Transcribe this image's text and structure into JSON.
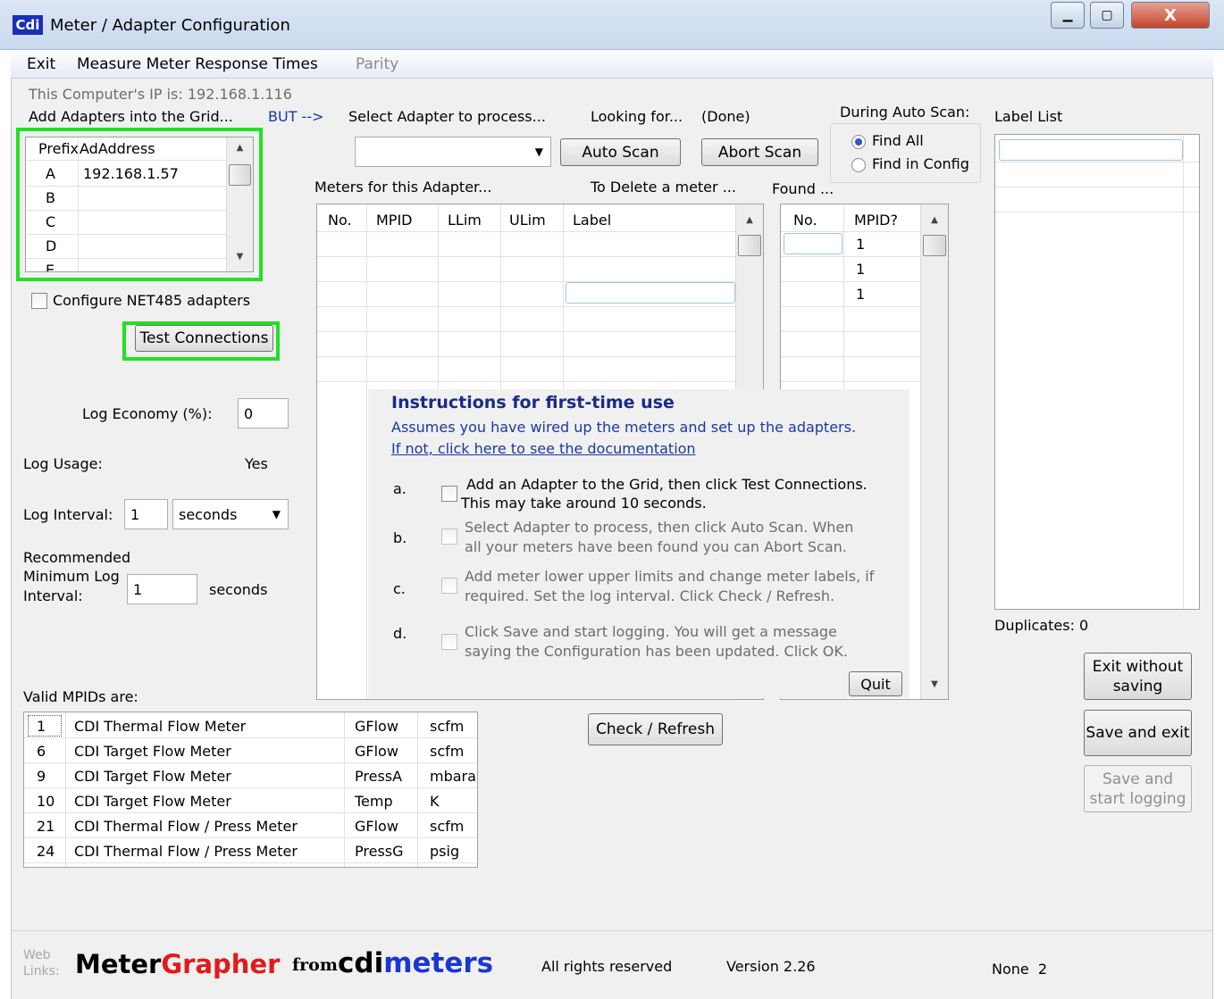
{
  "window": {
    "app_icon": "Cdi",
    "title": "Meter / Adapter Configuration",
    "min_glyph": "▁",
    "max_glyph": "▢",
    "close_glyph": "X"
  },
  "menu": {
    "items": [
      "Exit",
      "Measure Meter Response Times",
      "Parity"
    ]
  },
  "left": {
    "ip_text": "This Computer's IP is:  192.168.1.116",
    "add_adapters_text": "Add Adapters into the Grid...",
    "but_text": "BUT -->",
    "adapter_grid": {
      "headers": [
        "Prefix",
        "AdAddress"
      ],
      "rows": [
        {
          "prefix": "A",
          "address": "192.168.1.57"
        },
        {
          "prefix": "B",
          "address": ""
        },
        {
          "prefix": "C",
          "address": ""
        },
        {
          "prefix": "D",
          "address": ""
        },
        {
          "prefix": "E",
          "address": ""
        }
      ]
    },
    "net485_label": "Configure NET485 adapters",
    "test_connections": "Test Connections",
    "log_economy_label": "Log Economy (%):",
    "log_economy_value": "0",
    "log_usage_label": "Log Usage:",
    "log_usage_value": "Yes",
    "log_interval_label": "Log Interval:",
    "log_interval_value": "1",
    "log_interval_unit": "seconds",
    "recommended_label_1": "Recommended",
    "recommended_label_2": "Minimum Log",
    "recommended_label_3": "Interval:",
    "recommended_value": "1",
    "recommended_unit": "seconds",
    "valid_mpids_label": "Valid MPIDs are:",
    "mpids": [
      {
        "id": "1",
        "name": "CDI Thermal Flow Meter",
        "type": "GFlow",
        "unit": "scfm"
      },
      {
        "id": "6",
        "name": "CDI Target Flow Meter",
        "type": "GFlow",
        "unit": "scfm"
      },
      {
        "id": "9",
        "name": "CDI Target Flow Meter",
        "type": "PressA",
        "unit": "mbara"
      },
      {
        "id": "10",
        "name": "CDI Target Flow Meter",
        "type": "Temp",
        "unit": "K"
      },
      {
        "id": "21",
        "name": "CDI Thermal Flow / Press Meter",
        "type": "GFlow",
        "unit": "scfm"
      },
      {
        "id": "24",
        "name": "CDI Thermal Flow / Press Meter",
        "type": "PressG",
        "unit": "psig"
      }
    ]
  },
  "middle": {
    "select_adapter_text": "Select Adapter to process...",
    "looking_for_text": "Looking for...",
    "looking_status": "(Done)",
    "auto_scan": "Auto Scan",
    "abort_scan": "Abort Scan",
    "meters_for_adapter": "Meters for this Adapter...",
    "to_delete_text": "To Delete a meter ...",
    "found_text": "Found ...",
    "meters_headers": [
      "No.",
      "MPID",
      "LLim",
      "ULim",
      "Label"
    ],
    "found_headers": [
      "No.",
      "MPID?"
    ],
    "found_rows": [
      "1",
      "1",
      "1"
    ],
    "check_refresh": "Check / Refresh"
  },
  "instructions": {
    "title": "Instructions for first-time use",
    "subtitle": "Assumes you have wired up the meters and set up the adapters.",
    "link": "If not, click here to see the documentation",
    "steps": [
      {
        "letter": "a.",
        "line1": "Add an Adapter to the Grid, then click Test Connections.",
        "line2": "This may take around 10 seconds."
      },
      {
        "letter": "b.",
        "line1": "Select Adapter to process, then click Auto Scan.  When",
        "line2": "all your meters have been found you can Abort Scan."
      },
      {
        "letter": "c.",
        "line1": "Add meter lower  upper limits and change meter labels, if",
        "line2": "required.  Set the log interval.  Click Check / Refresh."
      },
      {
        "letter": "d.",
        "line1": "Click Save and start logging.  You will get a message",
        "line2": "saying the Configuration has been updated.  Click OK."
      }
    ],
    "quit": "Quit"
  },
  "right": {
    "during_auto_scan": "During Auto Scan:",
    "find_all": "Find All",
    "find_in_config": "Find in Config",
    "label_list": "Label List",
    "duplicates": "Duplicates: 0",
    "exit_without_saving_1": "Exit without",
    "exit_without_saving_2": "saving",
    "save_and_exit": "Save and exit",
    "save_and_start_1": "Save and",
    "save_and_start_2": "start logging"
  },
  "footer": {
    "web": "Web",
    "links": "Links:",
    "brand_meter": "Meter",
    "brand_grapher": "Grapher",
    "brand_from": "from",
    "brand_cdi": "cdi",
    "brand_meters": "meters",
    "rights": "All rights reserved",
    "version": "Version 2.26",
    "status": "None  2"
  },
  "colors": {
    "highlight_green": "#22e022",
    "brand_red": "#e01b1b",
    "brand_blue": "#1a37d0",
    "instruction_title": "#1a2a8a"
  }
}
